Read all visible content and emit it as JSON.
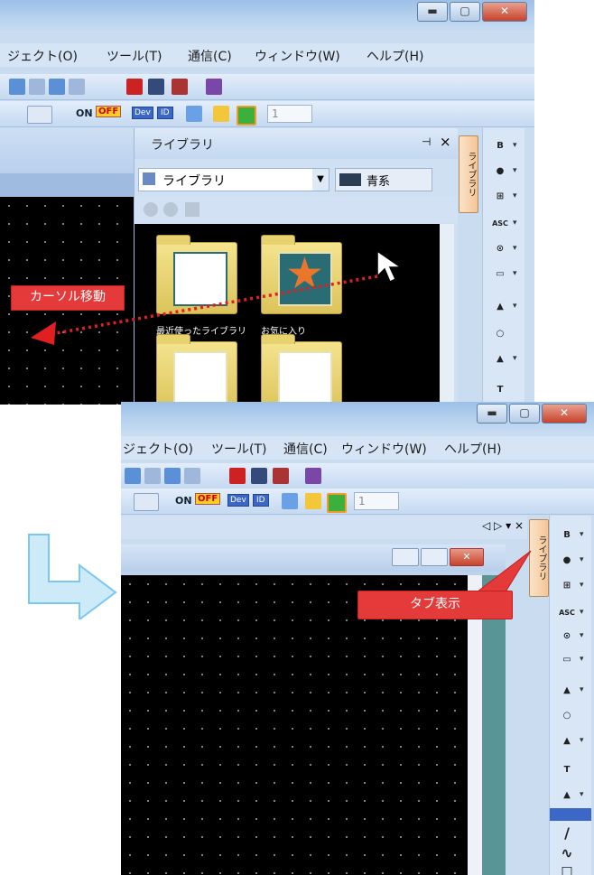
{
  "window1": {
    "menu": [
      "ジェクト(O)",
      "ツール(T)",
      "通信(C)",
      "ウィンドウ(W)",
      "ヘルプ(H)"
    ],
    "toolbar": {
      "on": "ON",
      "off": "OFF",
      "dev": "Dev",
      "id": "ID",
      "num": "1"
    },
    "library_panel": {
      "title": "ライブラリ",
      "pin": "⊣",
      "close": "×",
      "dropdown_value": "ライブラリ",
      "color_value": "青系",
      "folders": [
        {
          "label": "最近使ったライブラリ"
        },
        {
          "label": "お気に入り"
        },
        {
          "label": ""
        },
        {
          "label": ""
        }
      ]
    },
    "vertical_tab": "ライブラリ"
  },
  "window2": {
    "menu": [
      "ジェクト(O)",
      "ツール(T)",
      "通信(C)",
      "ウィンドウ(W)",
      "ヘルプ(H)"
    ],
    "toolbar": {
      "on": "ON",
      "off": "OFF",
      "dev": "Dev",
      "id": "ID",
      "num": "1"
    },
    "panel_controls": "◁ ▷ ▾ ×",
    "vertical_tab": "ライブラリ"
  },
  "annotations": {
    "cursor_move": "カーソル移動",
    "tab_display": "タブ表示"
  },
  "right_panel_icons": [
    "B",
    "💡",
    "⊞",
    "ASC",
    "⊙",
    "💬",
    "⚠",
    "🔍",
    "⚠",
    "T",
    "⚠"
  ],
  "colors": {
    "callout": "#e53a3a",
    "arrow": "#7cc7ee",
    "canvas": "#000000"
  }
}
